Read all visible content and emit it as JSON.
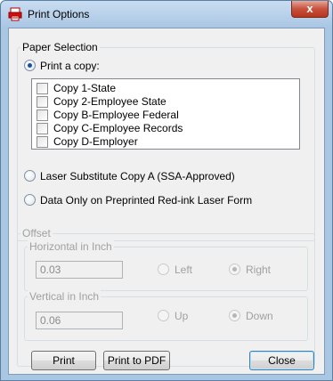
{
  "window": {
    "title": "Print Options",
    "close_glyph": "x"
  },
  "paper_selection": {
    "group_label": "Paper Selection",
    "options": [
      {
        "label": "Print a copy:",
        "checked": true
      },
      {
        "label": "Laser Substitute Copy A (SSA-Approved)",
        "checked": false
      },
      {
        "label": "Data Only on Preprinted Red-ink Laser Form",
        "checked": false
      }
    ],
    "copies": [
      {
        "label": "Copy 1-State",
        "checked": false
      },
      {
        "label": "Copy 2-Employee State",
        "checked": false
      },
      {
        "label": "Copy B-Employee Federal",
        "checked": false
      },
      {
        "label": "Copy C-Employee Records",
        "checked": false
      },
      {
        "label": "Copy D-Employer",
        "checked": false
      }
    ]
  },
  "offset": {
    "group_label": "Offset",
    "horizontal": {
      "group_label": "Horizontal in Inch",
      "value": "0.03",
      "left_label": "Left",
      "right_label": "Right",
      "selected": "Right"
    },
    "vertical": {
      "group_label": "Vertical in Inch",
      "value": "0.06",
      "up_label": "Up",
      "down_label": "Down",
      "selected": "Down"
    }
  },
  "buttons": {
    "print": "Print",
    "print_to_pdf": "Print to PDF",
    "close": "Close"
  },
  "icons": {
    "app": "printer-icon"
  },
  "colors": {
    "titlebar": "#aac6e4",
    "close": "#c7523d",
    "radio_accent": "#1b4fa0"
  }
}
